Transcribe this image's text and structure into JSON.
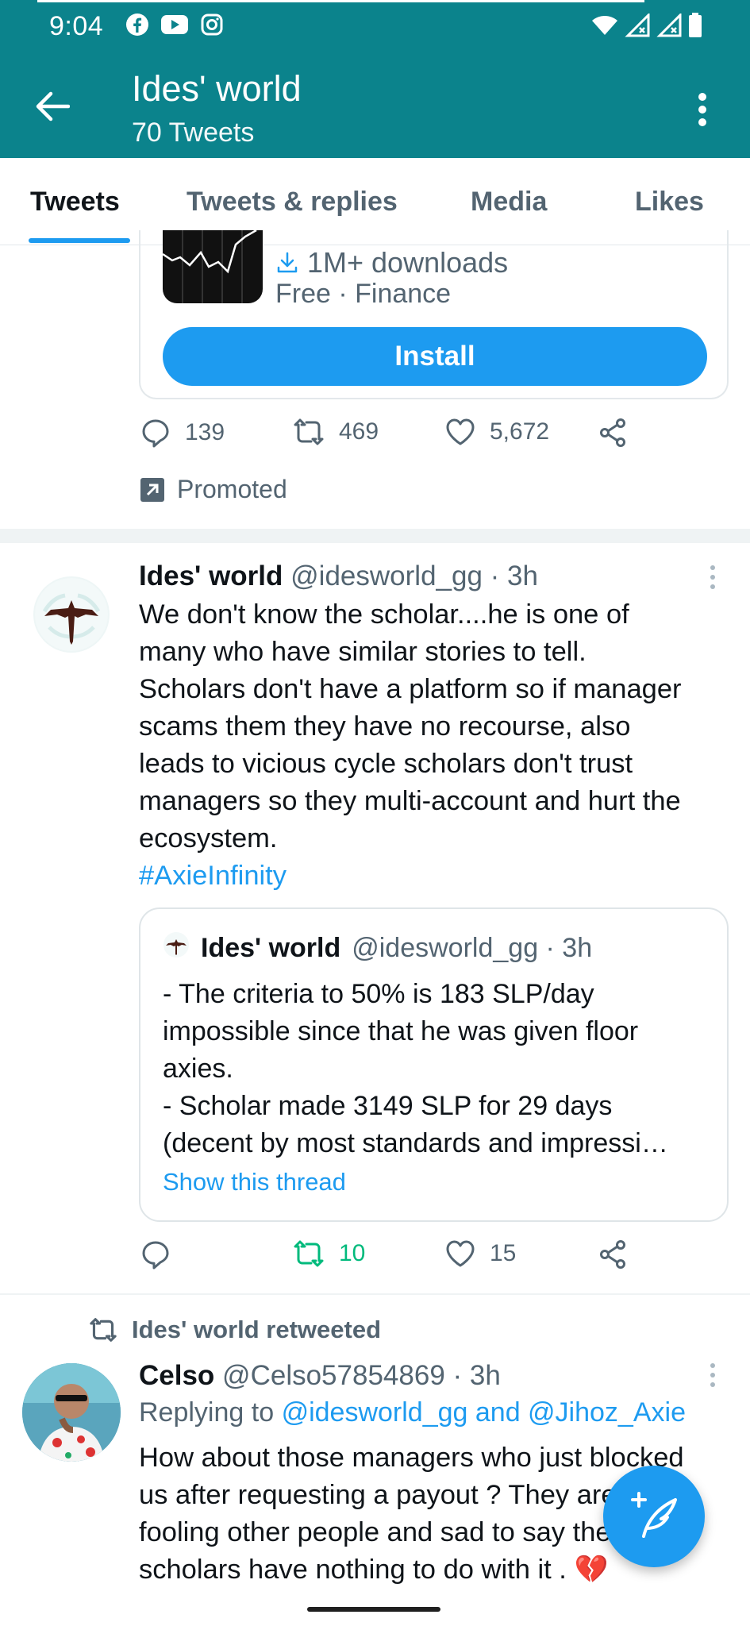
{
  "status_bar": {
    "time": "9:04",
    "app_icons": [
      "facebook-icon",
      "youtube-icon",
      "instagram-icon"
    ],
    "system_icons": [
      "wifi-icon",
      "signal-icon",
      "signal-icon",
      "battery-icon"
    ]
  },
  "header": {
    "title": "Ides' world",
    "subtitle": "70 Tweets"
  },
  "tabs": [
    {
      "label": "Tweets",
      "active": true
    },
    {
      "label": "Tweets & replies",
      "active": false
    },
    {
      "label": "Media",
      "active": false
    },
    {
      "label": "Likes",
      "active": false
    }
  ],
  "ad": {
    "downloads": "1M+ downloads",
    "meta": "Free · Finance",
    "install_label": "Install",
    "replies": "139",
    "retweets": "469",
    "likes": "5,672",
    "promoted_label": "Promoted"
  },
  "tweet1": {
    "name": "Ides' world",
    "meta": "@idesworld_gg · 3h",
    "lines": [
      "We don't know the scholar....he is one of",
      "many who have similar stories to tell.",
      "Scholars don't have a platform so if manager",
      "scams them they have no recourse, also",
      "leads to vicious cycle scholars don't trust",
      "managers so they multi-account and hurt the",
      "ecosystem."
    ],
    "hashtag": "#AxieInfinity",
    "quote": {
      "name": "Ides' world",
      "meta": "@idesworld_gg · 3h",
      "body": "- The criteria to 50% is 183 SLP/day\nimpossible since that he was given floor\naxies.\n- Scholar made 3149 SLP for 29 days\n(decent by most standards and impressi…",
      "link": "Show this thread"
    },
    "replies": "",
    "retweets": "10",
    "likes": "15",
    "retweet_color": "#00ba7c"
  },
  "retweet_banner": "Ides' world retweeted",
  "tweet2": {
    "name": "Celso",
    "meta": "@Celso57854869 · 3h",
    "replying_prefix": "Replying to",
    "replying_users": "@idesworld_gg and @Jihoz_Axie",
    "lines": [
      "How about those managers who just blocked",
      "us after requesting a payout ? They are",
      "fooling other people and sad to say the",
      "scholars have nothing to do with it . "
    ],
    "emoji": "💔"
  },
  "fab": {
    "icon": "compose-tweet-icon"
  },
  "colors": {
    "header_bg": "#0b838c",
    "accent": "#1d9bf0",
    "muted": "#536471"
  }
}
